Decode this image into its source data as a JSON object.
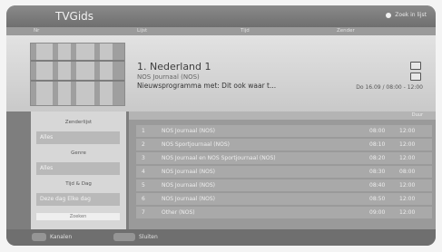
{
  "header": {
    "title": "TVGids",
    "top_right": "Zoek in lijst"
  },
  "column_headers": {
    "c1": "Nr",
    "c2": "Lijst",
    "c3": "Tijd",
    "c4": "Zender"
  },
  "info": {
    "channel_title": "1. Nederland 1",
    "sub": "NOS Journaal (NOS)",
    "desc": "Nieuwsprogramma met: Dit ook waar t...",
    "time": "Do 16.09 / 08:00 - 12:00"
  },
  "sidebar": {
    "h1": "Zenderlijst",
    "v1": "Alles",
    "h2": "Genre",
    "v2": "Alles",
    "h3": "Tijd & Dag",
    "v3": "Deze dag  Elke dag",
    "foot": "Zoeken"
  },
  "list_head": "Duur",
  "rows": [
    {
      "num": "1",
      "name": "NOS Journaal (NOS)",
      "time": "08:00",
      "dur": "12:00"
    },
    {
      "num": "2",
      "name": "NOS Sportjournaal (NOS)",
      "time": "08:10",
      "dur": "12:00"
    },
    {
      "num": "3",
      "name": "NOS Journaal en NOS Sportjournaal (NOS)",
      "time": "08:20",
      "dur": "12:00"
    },
    {
      "num": "4",
      "name": "NOS Journaal (NOS)",
      "time": "08:30",
      "dur": "08:00"
    },
    {
      "num": "5",
      "name": "NOS Journaal (NOS)",
      "time": "08:40",
      "dur": "12:00"
    },
    {
      "num": "6",
      "name": "NOS Journaal (NOS)",
      "time": "08:50",
      "dur": "12:00"
    },
    {
      "num": "7",
      "name": "Other (NOS)",
      "time": "09:00",
      "dur": "12:00"
    }
  ],
  "footer": {
    "k1_label": "Kanalen",
    "k2_label": "Sluiten"
  },
  "colors": {
    "screen": "#7e7e7e",
    "panel": "#c9c9c9",
    "row": "#a9a9a9"
  },
  "icons": {
    "status": "dot-icon",
    "rec": "record-icon",
    "lock": "lock-icon"
  }
}
